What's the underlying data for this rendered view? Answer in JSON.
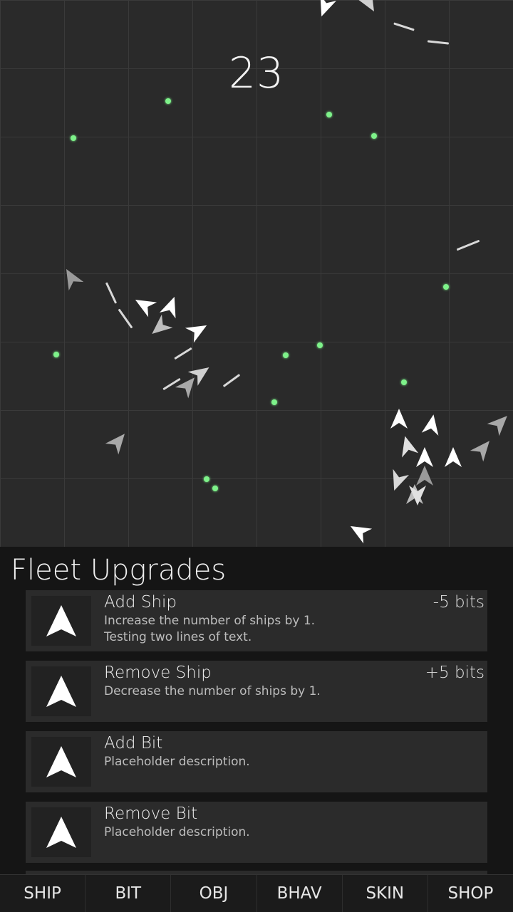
{
  "score": "23",
  "panel": {
    "title": "Fleet Upgrades",
    "upgrades": [
      {
        "name": "Add Ship",
        "description": "Increase the number of ships by 1.\nTesting two lines of text.",
        "cost": "-5 bits",
        "icon": "ship-arrow-icon"
      },
      {
        "name": "Remove Ship",
        "description": "Decrease the number of ships by 1.",
        "cost": "+5 bits",
        "icon": "ship-arrow-icon"
      },
      {
        "name": "Add Bit",
        "description": "Placeholder description.",
        "cost": "",
        "icon": "ship-arrow-icon"
      },
      {
        "name": "Remove Bit",
        "description": "Placeholder description.",
        "cost": "",
        "icon": "ship-arrow-icon"
      }
    ]
  },
  "tabs": [
    "SHIP",
    "BIT",
    "OBJ",
    "BHAV",
    "SKIN",
    "SHOP"
  ],
  "colors": {
    "bit": "#7ef28a",
    "ship": "#ffffff",
    "background": "#2a2a2a"
  }
}
